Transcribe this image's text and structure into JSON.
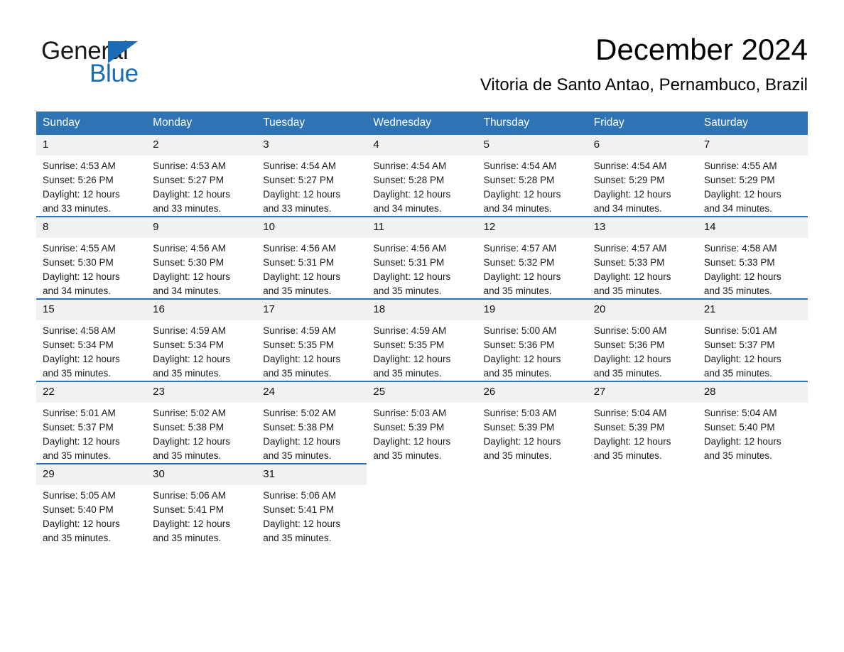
{
  "brand": {
    "name_part1": "General",
    "name_part2": "Blue",
    "triangle_color": "#1b6cb5"
  },
  "header": {
    "title": "December 2024",
    "subtitle": "Vitoria de Santo Antao, Pernambuco, Brazil"
  },
  "colors": {
    "header_blue": "#2e74b5",
    "daynum_background": "#f1f1f1",
    "text": "#1a1a1a"
  },
  "calendar": {
    "weekday_headers": [
      "Sunday",
      "Monday",
      "Tuesday",
      "Wednesday",
      "Thursday",
      "Friday",
      "Saturday"
    ],
    "labels": {
      "sunrise_prefix": "Sunrise:",
      "sunset_prefix": "Sunset:",
      "daylight_prefix": "Daylight:"
    },
    "weeks": [
      [
        {
          "day": "1",
          "sunrise": "Sunrise: 4:53 AM",
          "sunset": "Sunset: 5:26 PM",
          "daylight_line1": "Daylight: 12 hours",
          "daylight_line2": "and 33 minutes."
        },
        {
          "day": "2",
          "sunrise": "Sunrise: 4:53 AM",
          "sunset": "Sunset: 5:27 PM",
          "daylight_line1": "Daylight: 12 hours",
          "daylight_line2": "and 33 minutes."
        },
        {
          "day": "3",
          "sunrise": "Sunrise: 4:54 AM",
          "sunset": "Sunset: 5:27 PM",
          "daylight_line1": "Daylight: 12 hours",
          "daylight_line2": "and 33 minutes."
        },
        {
          "day": "4",
          "sunrise": "Sunrise: 4:54 AM",
          "sunset": "Sunset: 5:28 PM",
          "daylight_line1": "Daylight: 12 hours",
          "daylight_line2": "and 34 minutes."
        },
        {
          "day": "5",
          "sunrise": "Sunrise: 4:54 AM",
          "sunset": "Sunset: 5:28 PM",
          "daylight_line1": "Daylight: 12 hours",
          "daylight_line2": "and 34 minutes."
        },
        {
          "day": "6",
          "sunrise": "Sunrise: 4:54 AM",
          "sunset": "Sunset: 5:29 PM",
          "daylight_line1": "Daylight: 12 hours",
          "daylight_line2": "and 34 minutes."
        },
        {
          "day": "7",
          "sunrise": "Sunrise: 4:55 AM",
          "sunset": "Sunset: 5:29 PM",
          "daylight_line1": "Daylight: 12 hours",
          "daylight_line2": "and 34 minutes."
        }
      ],
      [
        {
          "day": "8",
          "sunrise": "Sunrise: 4:55 AM",
          "sunset": "Sunset: 5:30 PM",
          "daylight_line1": "Daylight: 12 hours",
          "daylight_line2": "and 34 minutes."
        },
        {
          "day": "9",
          "sunrise": "Sunrise: 4:56 AM",
          "sunset": "Sunset: 5:30 PM",
          "daylight_line1": "Daylight: 12 hours",
          "daylight_line2": "and 34 minutes."
        },
        {
          "day": "10",
          "sunrise": "Sunrise: 4:56 AM",
          "sunset": "Sunset: 5:31 PM",
          "daylight_line1": "Daylight: 12 hours",
          "daylight_line2": "and 35 minutes."
        },
        {
          "day": "11",
          "sunrise": "Sunrise: 4:56 AM",
          "sunset": "Sunset: 5:31 PM",
          "daylight_line1": "Daylight: 12 hours",
          "daylight_line2": "and 35 minutes."
        },
        {
          "day": "12",
          "sunrise": "Sunrise: 4:57 AM",
          "sunset": "Sunset: 5:32 PM",
          "daylight_line1": "Daylight: 12 hours",
          "daylight_line2": "and 35 minutes."
        },
        {
          "day": "13",
          "sunrise": "Sunrise: 4:57 AM",
          "sunset": "Sunset: 5:33 PM",
          "daylight_line1": "Daylight: 12 hours",
          "daylight_line2": "and 35 minutes."
        },
        {
          "day": "14",
          "sunrise": "Sunrise: 4:58 AM",
          "sunset": "Sunset: 5:33 PM",
          "daylight_line1": "Daylight: 12 hours",
          "daylight_line2": "and 35 minutes."
        }
      ],
      [
        {
          "day": "15",
          "sunrise": "Sunrise: 4:58 AM",
          "sunset": "Sunset: 5:34 PM",
          "daylight_line1": "Daylight: 12 hours",
          "daylight_line2": "and 35 minutes."
        },
        {
          "day": "16",
          "sunrise": "Sunrise: 4:59 AM",
          "sunset": "Sunset: 5:34 PM",
          "daylight_line1": "Daylight: 12 hours",
          "daylight_line2": "and 35 minutes."
        },
        {
          "day": "17",
          "sunrise": "Sunrise: 4:59 AM",
          "sunset": "Sunset: 5:35 PM",
          "daylight_line1": "Daylight: 12 hours",
          "daylight_line2": "and 35 minutes."
        },
        {
          "day": "18",
          "sunrise": "Sunrise: 4:59 AM",
          "sunset": "Sunset: 5:35 PM",
          "daylight_line1": "Daylight: 12 hours",
          "daylight_line2": "and 35 minutes."
        },
        {
          "day": "19",
          "sunrise": "Sunrise: 5:00 AM",
          "sunset": "Sunset: 5:36 PM",
          "daylight_line1": "Daylight: 12 hours",
          "daylight_line2": "and 35 minutes."
        },
        {
          "day": "20",
          "sunrise": "Sunrise: 5:00 AM",
          "sunset": "Sunset: 5:36 PM",
          "daylight_line1": "Daylight: 12 hours",
          "daylight_line2": "and 35 minutes."
        },
        {
          "day": "21",
          "sunrise": "Sunrise: 5:01 AM",
          "sunset": "Sunset: 5:37 PM",
          "daylight_line1": "Daylight: 12 hours",
          "daylight_line2": "and 35 minutes."
        }
      ],
      [
        {
          "day": "22",
          "sunrise": "Sunrise: 5:01 AM",
          "sunset": "Sunset: 5:37 PM",
          "daylight_line1": "Daylight: 12 hours",
          "daylight_line2": "and 35 minutes."
        },
        {
          "day": "23",
          "sunrise": "Sunrise: 5:02 AM",
          "sunset": "Sunset: 5:38 PM",
          "daylight_line1": "Daylight: 12 hours",
          "daylight_line2": "and 35 minutes."
        },
        {
          "day": "24",
          "sunrise": "Sunrise: 5:02 AM",
          "sunset": "Sunset: 5:38 PM",
          "daylight_line1": "Daylight: 12 hours",
          "daylight_line2": "and 35 minutes."
        },
        {
          "day": "25",
          "sunrise": "Sunrise: 5:03 AM",
          "sunset": "Sunset: 5:39 PM",
          "daylight_line1": "Daylight: 12 hours",
          "daylight_line2": "and 35 minutes."
        },
        {
          "day": "26",
          "sunrise": "Sunrise: 5:03 AM",
          "sunset": "Sunset: 5:39 PM",
          "daylight_line1": "Daylight: 12 hours",
          "daylight_line2": "and 35 minutes."
        },
        {
          "day": "27",
          "sunrise": "Sunrise: 5:04 AM",
          "sunset": "Sunset: 5:39 PM",
          "daylight_line1": "Daylight: 12 hours",
          "daylight_line2": "and 35 minutes."
        },
        {
          "day": "28",
          "sunrise": "Sunrise: 5:04 AM",
          "sunset": "Sunset: 5:40 PM",
          "daylight_line1": "Daylight: 12 hours",
          "daylight_line2": "and 35 minutes."
        }
      ],
      [
        {
          "day": "29",
          "sunrise": "Sunrise: 5:05 AM",
          "sunset": "Sunset: 5:40 PM",
          "daylight_line1": "Daylight: 12 hours",
          "daylight_line2": "and 35 minutes."
        },
        {
          "day": "30",
          "sunrise": "Sunrise: 5:06 AM",
          "sunset": "Sunset: 5:41 PM",
          "daylight_line1": "Daylight: 12 hours",
          "daylight_line2": "and 35 minutes."
        },
        {
          "day": "31",
          "sunrise": "Sunrise: 5:06 AM",
          "sunset": "Sunset: 5:41 PM",
          "daylight_line1": "Daylight: 12 hours",
          "daylight_line2": "and 35 minutes."
        },
        {
          "day": "",
          "sunrise": "",
          "sunset": "",
          "daylight_line1": "",
          "daylight_line2": ""
        },
        {
          "day": "",
          "sunrise": "",
          "sunset": "",
          "daylight_line1": "",
          "daylight_line2": ""
        },
        {
          "day": "",
          "sunrise": "",
          "sunset": "",
          "daylight_line1": "",
          "daylight_line2": ""
        },
        {
          "day": "",
          "sunrise": "",
          "sunset": "",
          "daylight_line1": "",
          "daylight_line2": ""
        }
      ]
    ]
  }
}
